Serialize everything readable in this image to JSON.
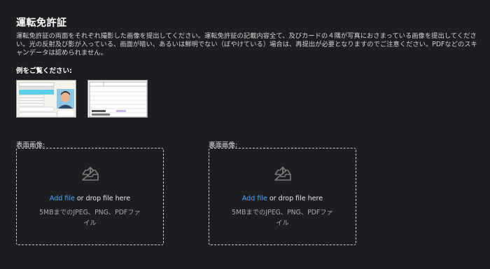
{
  "page": {
    "title": "運転免許証",
    "description": "運転免許証の両面をそれぞれ撮影した画像を提出してください。運転免許証の記載内容全て、及びカードの４隅が写真におさまっている画像を提出してください。光の反射及び影が入っている、画面が暗い、あるいは鮮明でない（ぼやけている）場合は、再提出が必要となりますのでご注意ください。PDFなどのスキャンデータは認められません。",
    "example_label": "例をご覧ください:"
  },
  "examples": {
    "front": "license-front-sample",
    "back": "license-back-sample"
  },
  "uploads": [
    {
      "label": "表面画像:",
      "add_file": "Add file",
      "drop_text": " or drop file here",
      "hint": "5MBまでのJPEG、PNG、PDFファイル",
      "icon": "upload-tray-icon"
    },
    {
      "label": "裏面画像:",
      "add_file": "Add file",
      "drop_text": " or drop file here",
      "hint": "5MBまでのJPEG、PNG、PDFファイル",
      "icon": "upload-tray-icon"
    }
  ],
  "colors": {
    "background": "#1d1e22",
    "link": "#4ea8ff",
    "dashed_border": "#cfcfcf"
  }
}
